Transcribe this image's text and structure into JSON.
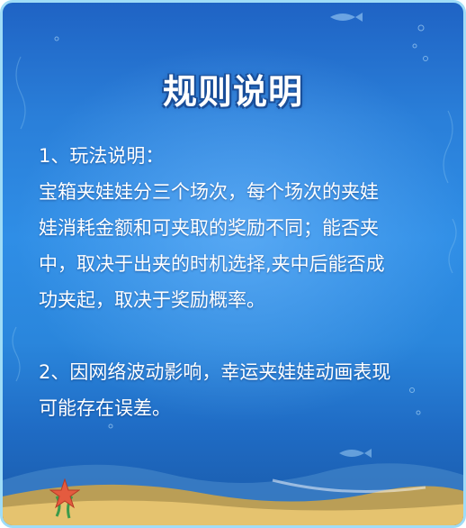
{
  "title": "规则说明",
  "rules": [
    {
      "lines": [
        "1、玩法说明：",
        "宝箱夹娃娃分三个场次，每个场次的夹娃",
        "娃消耗金额和可夹取的奖励不同；能否夹",
        "中，取决于出夹的时机选择,夹中后能否成",
        "功夹起，取决于奖励概率。"
      ]
    },
    {
      "lines": [
        "2、因网络波动影响，幸运夹娃娃动画表现",
        "可能存在误差。"
      ]
    }
  ],
  "colors": {
    "border": "#9fdcf7",
    "background_top": "#1f63c4",
    "background_mid": "#2f8ee6",
    "text": "#ffffff"
  }
}
